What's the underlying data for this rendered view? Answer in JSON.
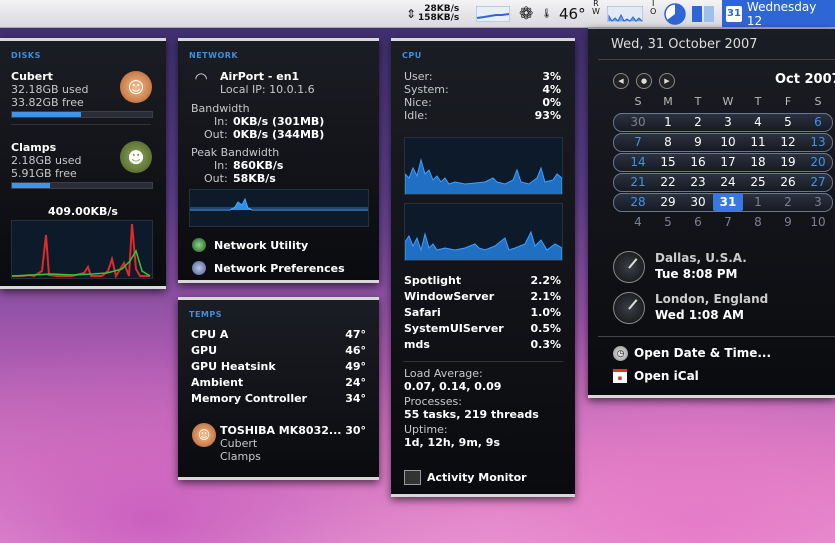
{
  "menubar": {
    "net_up": "28KB/s",
    "net_down": "158KB/s",
    "temp": "46°",
    "calendar_date": "Wednesday 12",
    "calendar_icon_day": "31"
  },
  "disks": {
    "title": "DISKS",
    "items": [
      {
        "name": "Cubert",
        "used": "32.18GB used",
        "free": "33.82GB free",
        "usage": 0.49
      },
      {
        "name": "Clamps",
        "used": "2.18GB used",
        "free": "5.91GB free",
        "usage": 0.27
      }
    ],
    "rate": "409.00KB/s"
  },
  "network": {
    "title": "NETWORK",
    "interface": "AirPort - en1",
    "local_ip": "Local IP: 10.0.1.6",
    "bandwidth_label": "Bandwidth",
    "in_label": "In:",
    "in_value": "0KB/s (301MB)",
    "out_label": "Out:",
    "out_value": "0KB/s (344MB)",
    "peak_label": "Peak Bandwidth",
    "peak_in_value": "860KB/s",
    "peak_out_value": "58KB/s",
    "utility_link": "Network Utility",
    "prefs_link": "Network Preferences"
  },
  "temps": {
    "title": "TEMPS",
    "rows": [
      {
        "label": "CPU A",
        "value": "47°"
      },
      {
        "label": "GPU",
        "value": "46°"
      },
      {
        "label": "GPU Heatsink",
        "value": "49°"
      },
      {
        "label": "Ambient",
        "value": "24°"
      },
      {
        "label": "Memory Controller",
        "value": "34°"
      }
    ],
    "drive_name": "TOSHIBA MK8032...",
    "drive_value": "30°",
    "drive_vol1": "Cubert",
    "drive_vol2": "Clamps"
  },
  "cpu": {
    "title": "CPU",
    "stats": [
      {
        "label": "User:",
        "value": "3%"
      },
      {
        "label": "System:",
        "value": "4%"
      },
      {
        "label": "Nice:",
        "value": "0%"
      },
      {
        "label": "Idle:",
        "value": "93%"
      }
    ],
    "processes": [
      {
        "name": "Spotlight",
        "value": "2.2%"
      },
      {
        "name": "WindowServer",
        "value": "2.1%"
      },
      {
        "name": "Safari",
        "value": "1.0%"
      },
      {
        "name": "SystemUIServer",
        "value": "0.5%"
      },
      {
        "name": "mds",
        "value": "0.3%"
      }
    ],
    "load_label": "Load Average:",
    "load_value": "0.07, 0.14, 0.09",
    "proc_label": "Processes:",
    "proc_value": "55 tasks, 219 threads",
    "uptime_label": "Uptime:",
    "uptime_value": "1d, 12h, 9m, 9s",
    "activity_link": "Activity Monitor"
  },
  "calendar": {
    "date_header": "Wed, 31 October 2007",
    "month": "Oct 2007",
    "weekdays": [
      "S",
      "M",
      "T",
      "W",
      "T",
      "F",
      "S"
    ],
    "weeks": [
      [
        "30",
        "1",
        "2",
        "3",
        "4",
        "5",
        "6"
      ],
      [
        "7",
        "8",
        "9",
        "10",
        "11",
        "12",
        "13"
      ],
      [
        "14",
        "15",
        "16",
        "17",
        "18",
        "19",
        "20"
      ],
      [
        "21",
        "22",
        "23",
        "24",
        "25",
        "26",
        "27"
      ],
      [
        "28",
        "29",
        "30",
        "31",
        "1",
        "2",
        "3"
      ],
      [
        "4",
        "5",
        "6",
        "7",
        "8",
        "9",
        "10"
      ]
    ],
    "clocks": [
      {
        "city": "Dallas, U.S.A.",
        "time": "Tue 8:08 PM"
      },
      {
        "city": "London, England",
        "time": "Wed 1:08 AM"
      }
    ],
    "open_datetime": "Open Date & Time...",
    "open_ical": "Open iCal"
  }
}
